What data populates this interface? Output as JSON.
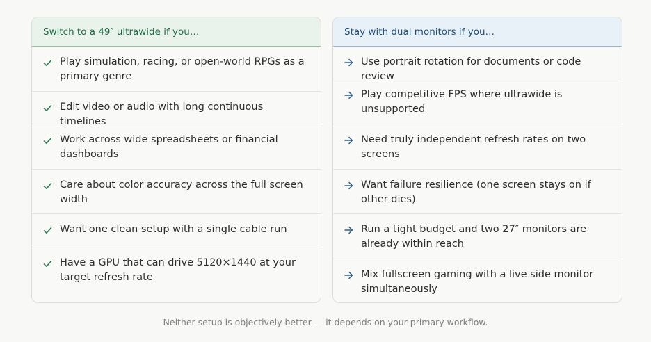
{
  "left_card": {
    "title": "Switch to a 49″ ultrawide if you…",
    "items": [
      "Play simulation, racing, or open-world RPGs as a primary genre",
      "Edit video or audio with long continuous timelines",
      "Work across wide spreadsheets or financial dashboards",
      "Care about color accuracy across the full screen width",
      "Want one clean setup with a single cable run",
      "Have a GPU that can drive 5120×1440 at your target refresh rate"
    ],
    "icon": "check-icon",
    "accent_color": "#1f6b45"
  },
  "right_card": {
    "title": "Stay with dual monitors if you…",
    "items": [
      "Use portrait rotation for documents or code review",
      "Play competitive FPS where ultrawide is unsupported",
      "Need truly independent refresh rates on two screens",
      "Want failure resilience (one screen stays on if other dies)",
      "Run a tight budget and two 27″ monitors are already within reach",
      "Mix fullscreen gaming with a live side monitor simultaneously"
    ],
    "icon": "arrow-right-icon",
    "accent_color": "#1f4f7a"
  },
  "footer": {
    "note": "Neither setup is objectively better — it depends on your primary workflow."
  }
}
